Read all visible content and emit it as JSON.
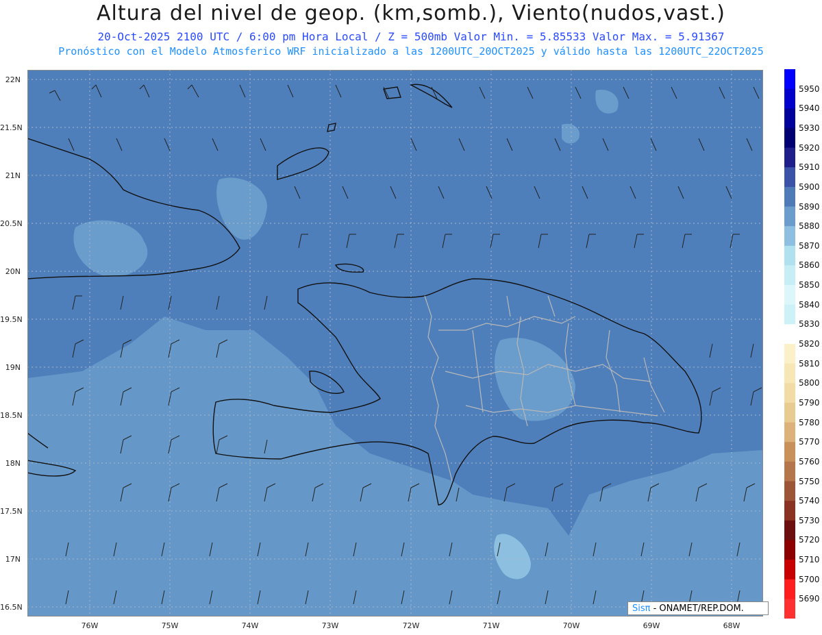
{
  "header": {
    "title": "Altura del nivel de geop. (km,somb.), Viento(nudos,vast.)",
    "subtitle1": "20-Oct-2025  2100 UTC / 6:00 pm Hora Local / Z = 500mb    Valor Min. = 5.85533  Valor Max. = 5.91367",
    "subtitle2": "Pronóstico con el Modelo Atmosferico WRF inicializado a las 1200UTC_20OCT2025 y válido hasta las  1200UTC_22OCT2025"
  },
  "axes": {
    "y_labels": [
      "22N",
      "21.5N",
      "21N",
      "20.5N",
      "20N",
      "19.5N",
      "19N",
      "18.5N",
      "18N",
      "17.5N",
      "17N",
      "16.5N"
    ],
    "x_labels": [
      "76W",
      "75W",
      "74W",
      "73W",
      "72W",
      "71W",
      "70W",
      "69W",
      "68W"
    ]
  },
  "colorbar": {
    "levels": [
      5950,
      5940,
      5930,
      5920,
      5910,
      5900,
      5890,
      5880,
      5870,
      5860,
      5850,
      5840,
      5830,
      5820,
      5810,
      5800,
      5790,
      5780,
      5770,
      5760,
      5750,
      5740,
      5730,
      5720,
      5710,
      5700,
      5690
    ],
    "colors": [
      "#0000ff",
      "#0000cc",
      "#00009a",
      "#000072",
      "#1f1f8c",
      "#3a52a8",
      "#4e7ab8",
      "#6a9ccc",
      "#8cbfe0",
      "#b1e0ef",
      "#c8eef5",
      "#dcf6fa",
      "#ccf2f8",
      "#ffffff",
      "#fbf0c8",
      "#f7e6b6",
      "#f2dba4",
      "#e8cb91",
      "#dcb17a",
      "#c8915a",
      "#b4764a",
      "#9c5536",
      "#8a3322",
      "#6e0f0f",
      "#8c0000",
      "#c80000",
      "#ff1e1e",
      "#ff3030"
    ]
  },
  "credit": {
    "brand": "Sisπ",
    "text": "- ONAMET/REP.DOM."
  }
}
